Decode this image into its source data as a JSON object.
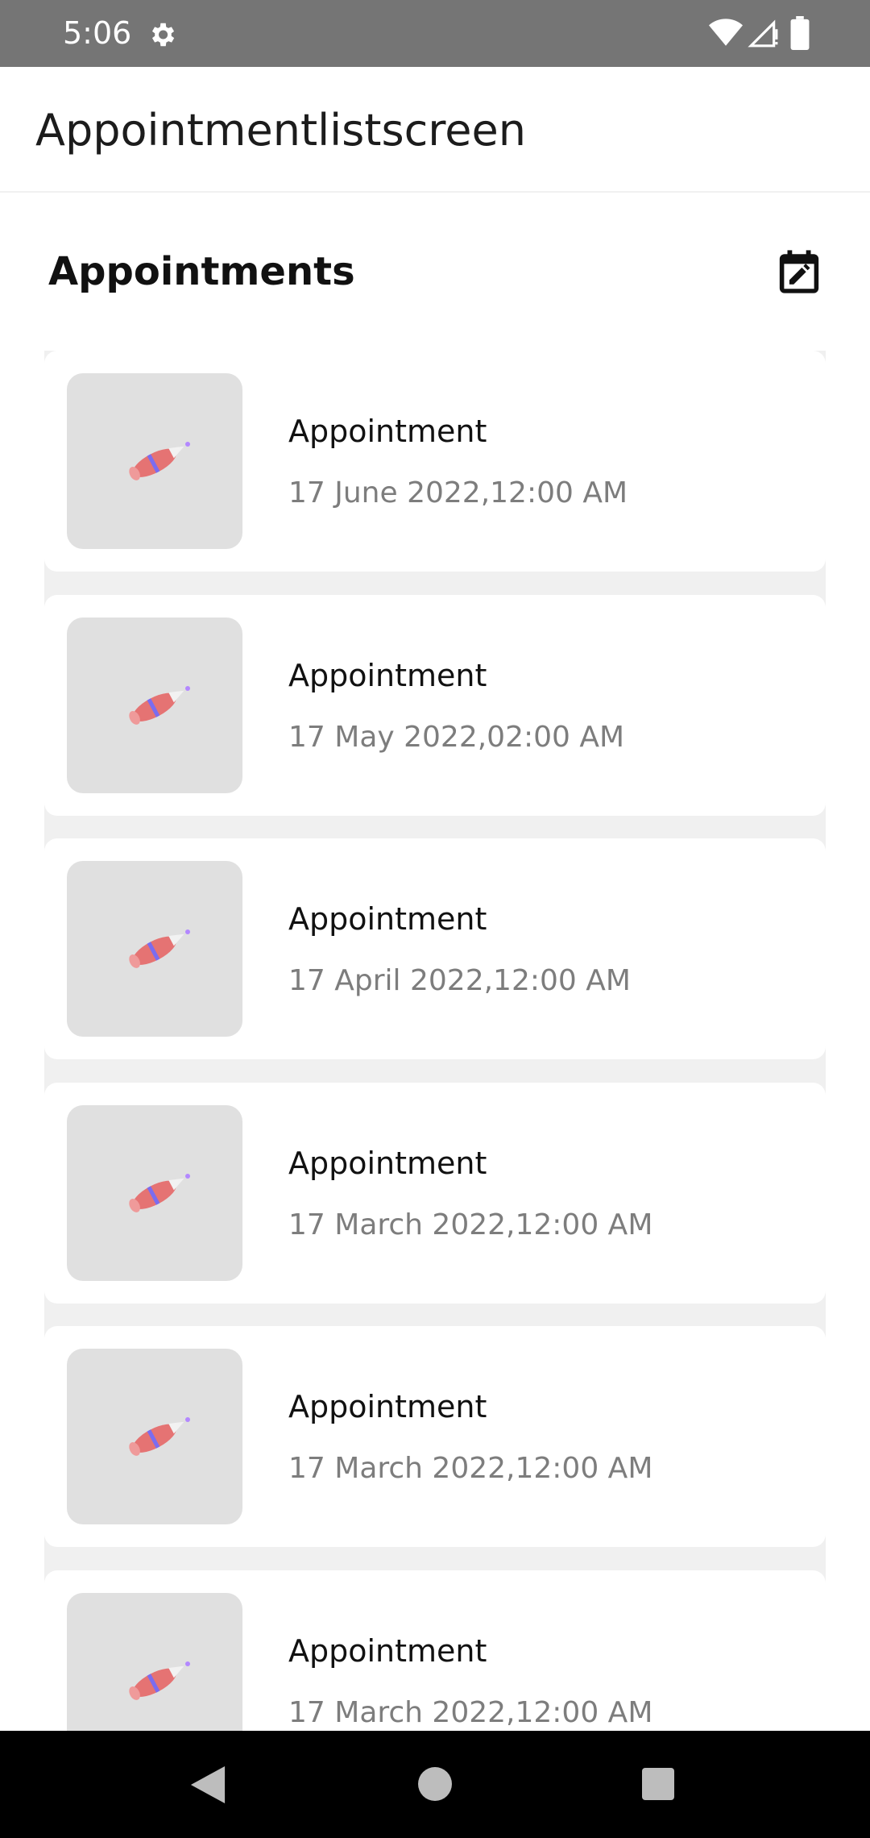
{
  "status_bar": {
    "time": "5:06",
    "icons": [
      "gear-icon",
      "wifi-icon",
      "signal-icon",
      "battery-icon"
    ]
  },
  "app_bar": {
    "title": "Appointmentlistscreen"
  },
  "section": {
    "title": "Appointments",
    "action_icon": "calendar-edit-icon"
  },
  "appointments": [
    {
      "title": "Appointment",
      "date": "17 June 2022,12:00 AM"
    },
    {
      "title": "Appointment",
      "date": "17 May 2022,02:00 AM"
    },
    {
      "title": "Appointment",
      "date": "17 April 2022,12:00 AM"
    },
    {
      "title": "Appointment",
      "date": "17 March 2022,12:00 AM"
    },
    {
      "title": "Appointment",
      "date": "17 March 2022,12:00 AM"
    },
    {
      "title": "Appointment",
      "date": "17 March 2022,12:00 AM"
    }
  ],
  "thumbnail_icon": "rocket-icon",
  "nav_bar": {
    "icons": [
      "back-icon",
      "home-icon",
      "recents-icon"
    ]
  },
  "colors": {
    "status_bar": "#757575",
    "list_background": "#f0f0f0",
    "thumbnail_background": "#e0e0e0",
    "date_text": "#7d7d7d"
  }
}
